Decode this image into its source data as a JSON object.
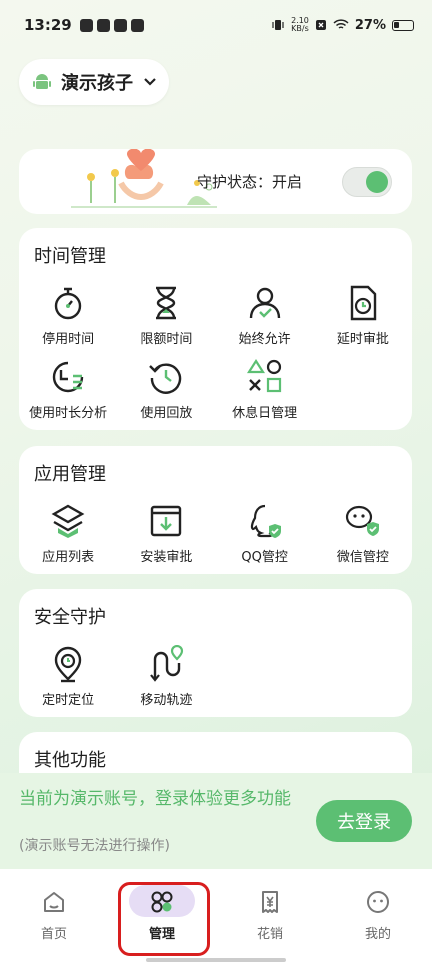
{
  "status_bar": {
    "time": "13:29",
    "speed_top": "2.10",
    "speed_bottom": "KB/s",
    "battery": "27%"
  },
  "child": {
    "name": "演示孩子"
  },
  "protect": {
    "label": "守护状态：开启",
    "enabled": true
  },
  "time_management": {
    "title": "时间管理",
    "items": [
      {
        "label": "停用时间",
        "icon": "stopwatch-icon"
      },
      {
        "label": "限额时间",
        "icon": "hourglass-icon"
      },
      {
        "label": "始终允许",
        "icon": "user-check-icon"
      },
      {
        "label": "延时审批",
        "icon": "document-clock-icon"
      },
      {
        "label": "使用时长分析",
        "icon": "clock-analysis-icon"
      },
      {
        "label": "使用回放",
        "icon": "replay-icon"
      },
      {
        "label": "休息日管理",
        "icon": "shapes-icon"
      }
    ]
  },
  "app_management": {
    "title": "应用管理",
    "items": [
      {
        "label": "应用列表",
        "icon": "box-icon"
      },
      {
        "label": "安装审批",
        "icon": "install-icon"
      },
      {
        "label": "QQ管控",
        "icon": "qq-shield-icon"
      },
      {
        "label": "微信管控",
        "icon": "wechat-shield-icon"
      }
    ]
  },
  "security": {
    "title": "安全守护",
    "items": [
      {
        "label": "定时定位",
        "icon": "location-timer-icon"
      },
      {
        "label": "移动轨迹",
        "icon": "track-icon"
      }
    ]
  },
  "other": {
    "title": "其他功能"
  },
  "demo_banner": {
    "main": "当前为演示账号，登录体验更多功能",
    "sub": "(演示账号无法进行操作)",
    "button": "去登录"
  },
  "nav": [
    {
      "label": "首页",
      "icon": "home-icon"
    },
    {
      "label": "管理",
      "icon": "grid-icon"
    },
    {
      "label": "花销",
      "icon": "yuan-card-icon"
    },
    {
      "label": "我的",
      "icon": "smile-icon"
    }
  ],
  "colors": {
    "accent": "#5cbf73",
    "highlight": "#d81e1e",
    "active_pill": "#e6ddf5"
  }
}
